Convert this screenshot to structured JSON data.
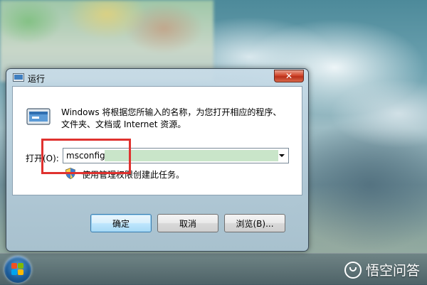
{
  "run_dialog": {
    "title": "运行",
    "description_line1": "Windows 将根据您所输入的名称，为您打开相应的程序、",
    "description_line2": "文件夹、文档或 Internet 资源。",
    "open_label": "打开(O):",
    "open_value": "msconfig",
    "admin_note": "使用管理权限创建此任务。",
    "buttons": {
      "ok": "确定",
      "cancel": "取消",
      "browse": "浏览(B)..."
    }
  },
  "watermark": {
    "text": "悟空问答"
  },
  "colors": {
    "highlight_box": "#e0322f",
    "input_selection": "#c9e5c9",
    "ok_button_border": "#3c7fb1"
  }
}
